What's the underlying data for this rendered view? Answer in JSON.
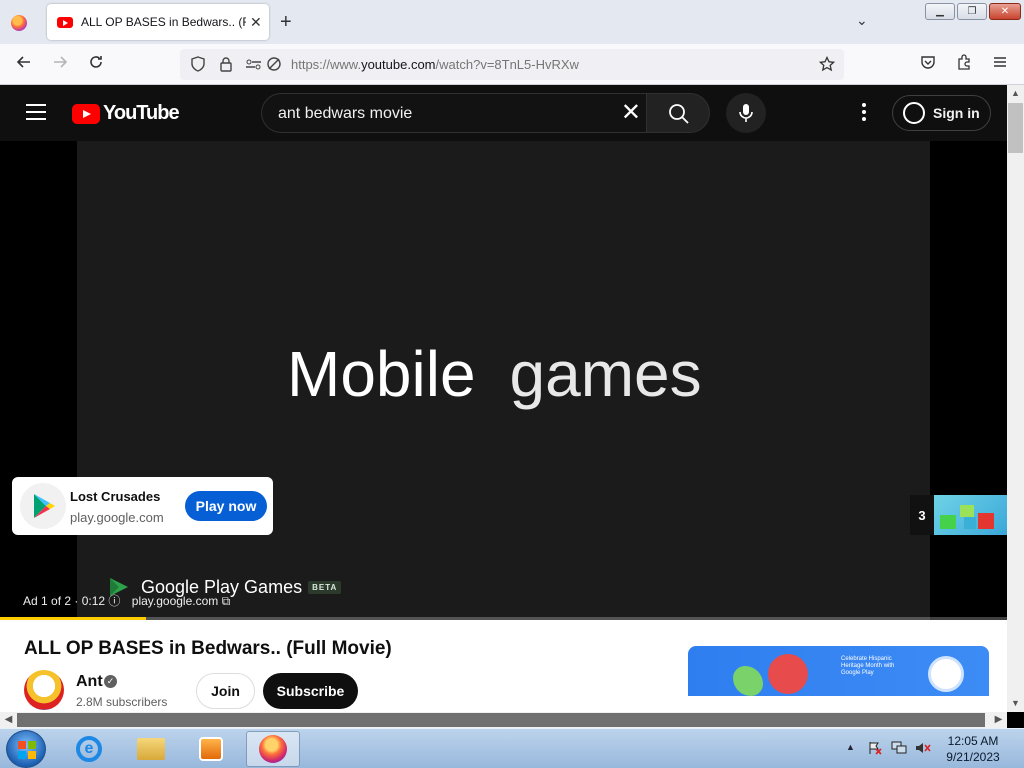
{
  "browser": {
    "tab_title": "ALL OP BASES in Bedwars.. (Full Movie) - YouTube",
    "tab_close": "✕",
    "new_tab": "+",
    "tab_list": "⌄",
    "url_prefix": "https://www.",
    "url_domain": "youtube.com",
    "url_path": "/watch?v=8TnL5-HvRXw",
    "window_controls": {
      "min": "▁",
      "max": "❐",
      "close": "✕"
    }
  },
  "youtube": {
    "logo_text": "YouTube",
    "search_query": "ant bedwars movie",
    "search_clear": "✕",
    "sign_in": "Sign in"
  },
  "ad": {
    "headline_word1": "Mobile",
    "headline_word2": "games",
    "brand": "Google Play Games",
    "brand_badge": "BETA",
    "card_title": "Lost Crusades",
    "card_domain": "play.google.com",
    "card_cta": "Play now",
    "ad_counter": "Ad 1 of 2 · 0:12",
    "info_glyph": "ⓘ",
    "footer_domain": "play.google.com",
    "external_glyph": "⧉",
    "skip_count": "3",
    "progress_fraction": 0.145
  },
  "video": {
    "title": "ALL OP BASES in Bedwars.. (Full Movie)",
    "channel": "Ant",
    "verified_glyph": "✓",
    "subscribers": "2.8M subscribers",
    "join": "Join",
    "subscribe": "Subscribe",
    "promo_text": "Celebrate Hispanic Heritage Month with Google Play"
  },
  "scrollbars": {
    "up": "▲",
    "down": "▼",
    "left": "◀",
    "right": "▶"
  },
  "taskbar": {
    "tray_arrow": "▲",
    "time": "12:05 AM",
    "date": "9/21/2023"
  }
}
